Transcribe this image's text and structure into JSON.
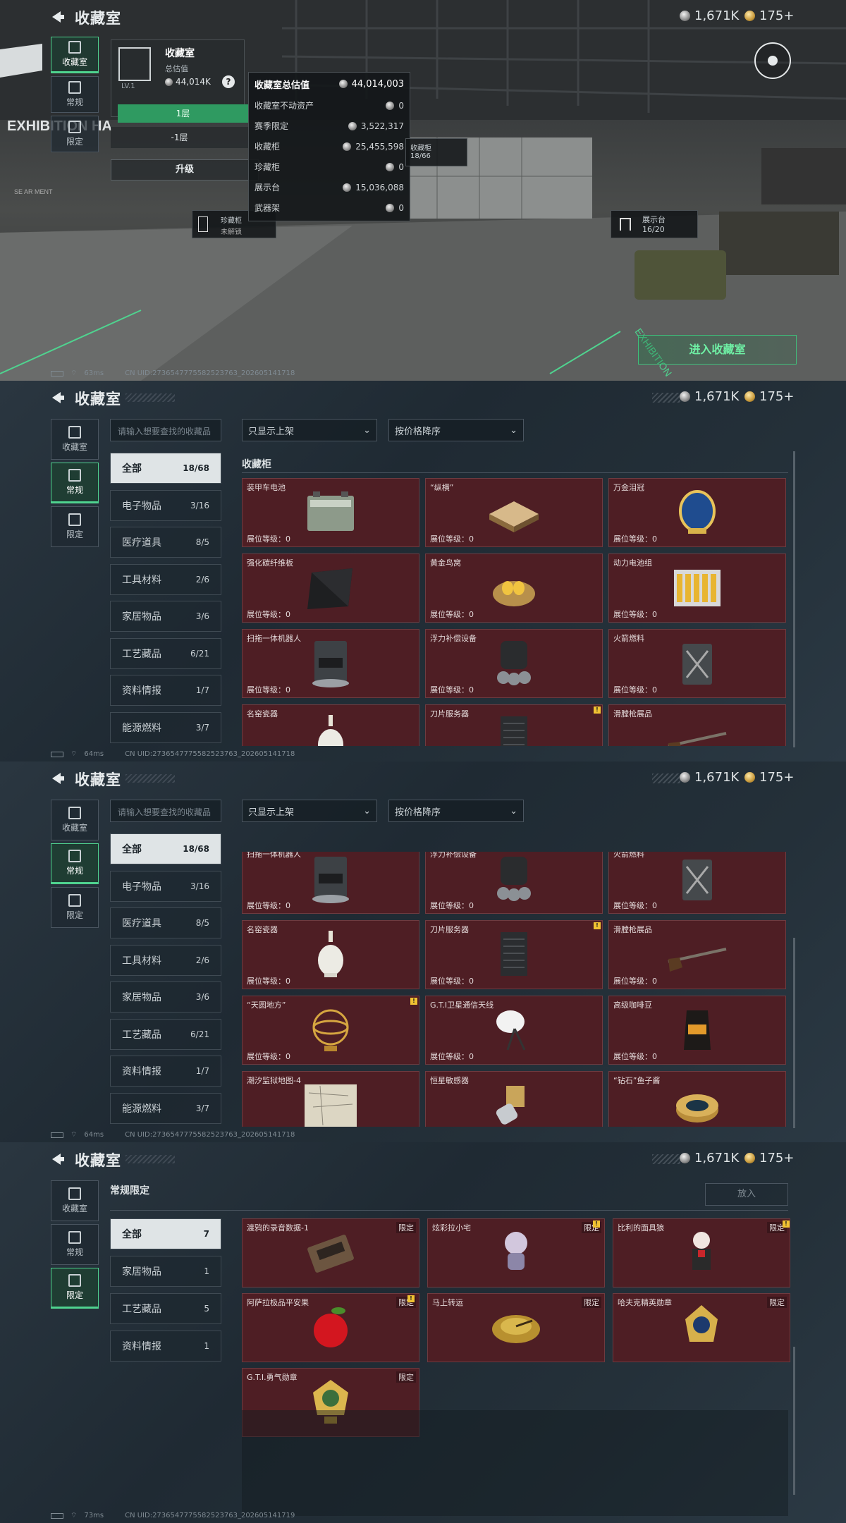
{
  "header": {
    "title": "收藏室",
    "currency_silver": "1,671K",
    "currency_gold": "175+"
  },
  "status": [
    {
      "ping": "63ms",
      "uid": "CN UID:2736547775582523763_202605141718"
    },
    {
      "ping": "64ms",
      "uid": "CN UID:2736547775582523763_202605141718"
    },
    {
      "ping": "64ms",
      "uid": "CN UID:2736547775582523763_202605141718"
    },
    {
      "ping": "73ms",
      "uid": "CN UID:2736547775582523763_202605141719"
    }
  ],
  "side_tabs": {
    "room": "收藏室",
    "regular": "常规",
    "limited": "限定"
  },
  "overview": {
    "room_name": "收藏室",
    "total_label": "总估值",
    "total_value": "44,014K",
    "level": "LV.1",
    "floor1": "1层",
    "floor_minus1": "-1层",
    "upgrade": "升级",
    "rare_cabinet": "珍藏柜",
    "rare_cabinet_status": "未解锁",
    "cabinet_tag": "收藏柜",
    "cabinet_count": "18/66",
    "display_tag": "展示台",
    "display_count": "16/20",
    "enter_button": "进入收藏室",
    "wall_text": "EXHIBITION HA",
    "wall_text2": "SE AR MENT",
    "floor_text": "EXHIBITION"
  },
  "valuation": {
    "title": "收藏室总估值",
    "total": "44,014,003",
    "rows": [
      {
        "label": "收藏室不动资产",
        "value": "0"
      },
      {
        "label": "赛季限定",
        "value": "3,522,317"
      },
      {
        "label": "收藏柜",
        "value": "25,455,598"
      },
      {
        "label": "珍藏柜",
        "value": "0"
      },
      {
        "label": "展示台",
        "value": "15,036,088"
      },
      {
        "label": "武器架",
        "value": "0"
      }
    ]
  },
  "filters": {
    "search_placeholder": "请输入想要查找的收藏品",
    "shelf_filter": "只显示上架",
    "sort": "按价格降序"
  },
  "categories": [
    {
      "label": "全部",
      "count": "18/68"
    },
    {
      "label": "电子物品",
      "count": "3/16"
    },
    {
      "label": "医疗道具",
      "count": "8/5"
    },
    {
      "label": "工具材料",
      "count": "2/6"
    },
    {
      "label": "家居物品",
      "count": "3/6"
    },
    {
      "label": "工艺藏品",
      "count": "6/21"
    },
    {
      "label": "资料情报",
      "count": "1/7"
    },
    {
      "label": "能源燃料",
      "count": "3/7"
    }
  ],
  "cabinet_section": "收藏柜",
  "level_label": "展位等级：0",
  "items": [
    {
      "name": "装甲车电池",
      "icon": "battery-icon"
    },
    {
      "name": "“纵横”",
      "icon": "chessboard-icon"
    },
    {
      "name": "万金泪冠",
      "icon": "jeweled-egg-icon"
    },
    {
      "name": "强化碳纤维板",
      "icon": "carbon-plate-icon"
    },
    {
      "name": "黄金鸟窝",
      "icon": "golden-nest-icon"
    },
    {
      "name": "动力电池组",
      "icon": "battery-pack-icon"
    },
    {
      "name": "扫拖一体机器人",
      "icon": "robot-vacuum-icon"
    },
    {
      "name": "浮力补偿设备",
      "icon": "buoyancy-device-icon"
    },
    {
      "name": "火箭燃料",
      "icon": "fuel-can-icon"
    },
    {
      "name": "名窑瓷器",
      "icon": "porcelain-vase-icon"
    },
    {
      "name": "刀片服务器",
      "icon": "blade-server-icon"
    },
    {
      "name": "滑膛枪展品",
      "icon": "musket-icon"
    },
    {
      "name": "“天圆地方”",
      "icon": "armillary-sphere-icon"
    },
    {
      "name": "G.T.I卫星通信天线",
      "icon": "satellite-dish-icon"
    },
    {
      "name": "高级咖啡豆",
      "icon": "coffee-bag-icon"
    },
    {
      "name": "潮汐监狱地图-4",
      "icon": "map-icon"
    },
    {
      "name": "恒星敏感器",
      "icon": "star-sensor-icon"
    },
    {
      "name": "“钻石”鱼子酱",
      "icon": "caviar-tin-icon"
    }
  ],
  "limited": {
    "section": "常规限定",
    "put_button": "放入",
    "tag": "限定",
    "categories": [
      {
        "label": "全部",
        "count": "7"
      },
      {
        "label": "家居物品",
        "count": "1"
      },
      {
        "label": "工艺藏品",
        "count": "5"
      },
      {
        "label": "资料情报",
        "count": "1"
      }
    ],
    "items": [
      {
        "name": "渡鸦的录音数据-1",
        "icon": "cassette-icon"
      },
      {
        "name": "炫彩拉小宅",
        "icon": "figurine-icon"
      },
      {
        "name": "比利的面具狼",
        "icon": "puppet-icon"
      },
      {
        "name": "阿萨拉极品平安果",
        "icon": "apple-icon"
      },
      {
        "name": "马上转运",
        "icon": "turntable-icon"
      },
      {
        "name": "哈夫克精英勋章",
        "icon": "elite-medal-icon"
      },
      {
        "name": "G.T.I.勇气勋章",
        "icon": "courage-medal-icon"
      }
    ]
  },
  "colors": {
    "accent": "#4fd38f",
    "card": "#4e1e24",
    "warn": "#f1c232"
  }
}
